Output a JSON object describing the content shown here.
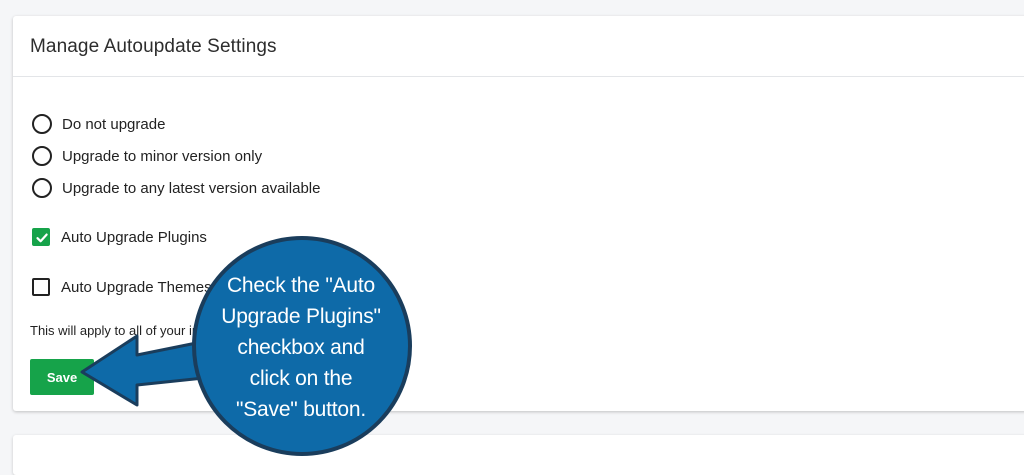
{
  "settings": {
    "title": "Manage Autoupdate Settings",
    "radio_options": [
      {
        "label": "Do not upgrade",
        "selected": false
      },
      {
        "label": "Upgrade to minor version only",
        "selected": false
      },
      {
        "label": "Upgrade to any latest version available",
        "selected": false
      }
    ],
    "auto_upgrade_plugins": {
      "label": "Auto Upgrade Plugins",
      "checked": true
    },
    "auto_upgrade_themes": {
      "label": "Auto Upgrade Themes",
      "checked": false
    },
    "note": "This will apply to all of your installations",
    "save_label": "Save"
  },
  "callout": {
    "lines": [
      "Check the \"Auto",
      "Upgrade Plugins\"",
      "checkbox and",
      "click on the",
      "\"Save\" button."
    ]
  },
  "colors": {
    "accent_green": "#16a34a",
    "callout_blue": "#0e6aa8",
    "callout_border": "#1a3d5c"
  }
}
